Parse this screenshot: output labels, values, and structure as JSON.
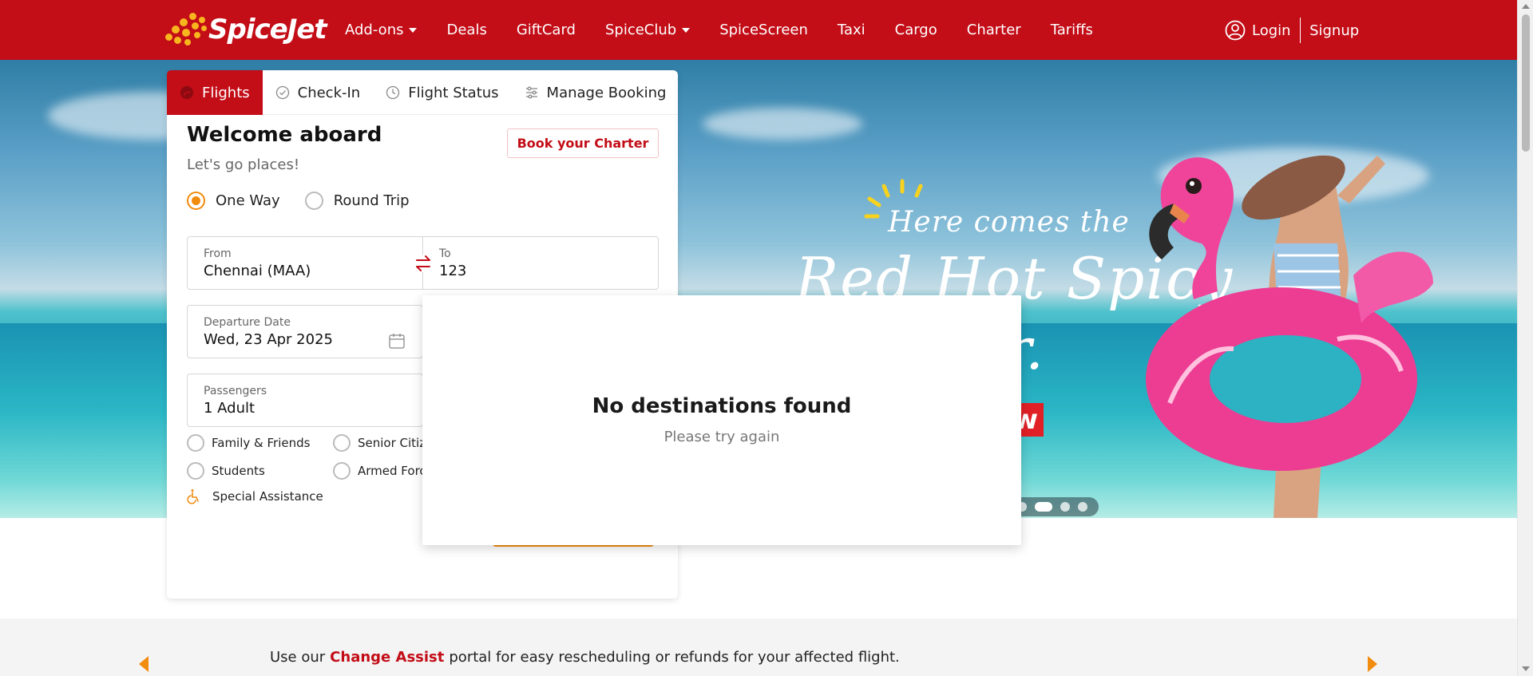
{
  "brand": {
    "name": "SpiceJet"
  },
  "nav": {
    "items": [
      {
        "label": "Add-ons",
        "has_dropdown": true
      },
      {
        "label": "Deals",
        "has_dropdown": false
      },
      {
        "label": "GiftCard",
        "has_dropdown": false
      },
      {
        "label": "SpiceClub",
        "has_dropdown": true
      },
      {
        "label": "SpiceScreen",
        "has_dropdown": false
      },
      {
        "label": "Taxi",
        "has_dropdown": false
      },
      {
        "label": "Cargo",
        "has_dropdown": false
      },
      {
        "label": "Charter",
        "has_dropdown": false
      },
      {
        "label": "Tariffs",
        "has_dropdown": false
      }
    ],
    "login_label": "Login",
    "signup_label": "Signup"
  },
  "hero": {
    "line1": "Here comes the",
    "line2": "Red Hot Spicy",
    "line3": "er.",
    "cta_fragment": "w",
    "carousel": {
      "slide_count": 4,
      "active_index": 1
    }
  },
  "booking": {
    "tabs": [
      {
        "label": "Flights",
        "icon": "plane-icon",
        "active": true
      },
      {
        "label": "Check-In",
        "icon": "check-circle-icon",
        "active": false
      },
      {
        "label": "Flight Status",
        "icon": "clock-icon",
        "active": false
      },
      {
        "label": "Manage Booking",
        "icon": "sliders-icon",
        "active": false
      }
    ],
    "welcome": "Welcome aboard",
    "subtitle": "Let's go places!",
    "charter_button": "Book your Charter",
    "trip_types": [
      {
        "label": "One Way",
        "selected": true
      },
      {
        "label": "Round Trip",
        "selected": false
      }
    ],
    "from": {
      "label": "From",
      "value": "Chennai (MAA)"
    },
    "to": {
      "label": "To",
      "value": "123"
    },
    "departure": {
      "label": "Departure Date",
      "value": "Wed, 23 Apr 2025"
    },
    "passengers": {
      "label": "Passengers",
      "value": "1 Adult"
    },
    "fare_types": [
      {
        "label": "Family & Friends"
      },
      {
        "label": "Senior Citiz"
      },
      {
        "label": "Students"
      },
      {
        "label": "Armed Forc"
      }
    ],
    "special_assistance": "Special Assistance"
  },
  "dropdown": {
    "title": "No destinations found",
    "subtitle": "Please try again"
  },
  "notice": {
    "prefix": "Use our",
    "link": "Change Assist",
    "suffix": "portal for easy rescheduling or refunds for your affected flight."
  },
  "colors": {
    "brand_red": "#c30d17",
    "accent_orange": "#f28c0f",
    "logo_yellow": "#f7b51e"
  }
}
